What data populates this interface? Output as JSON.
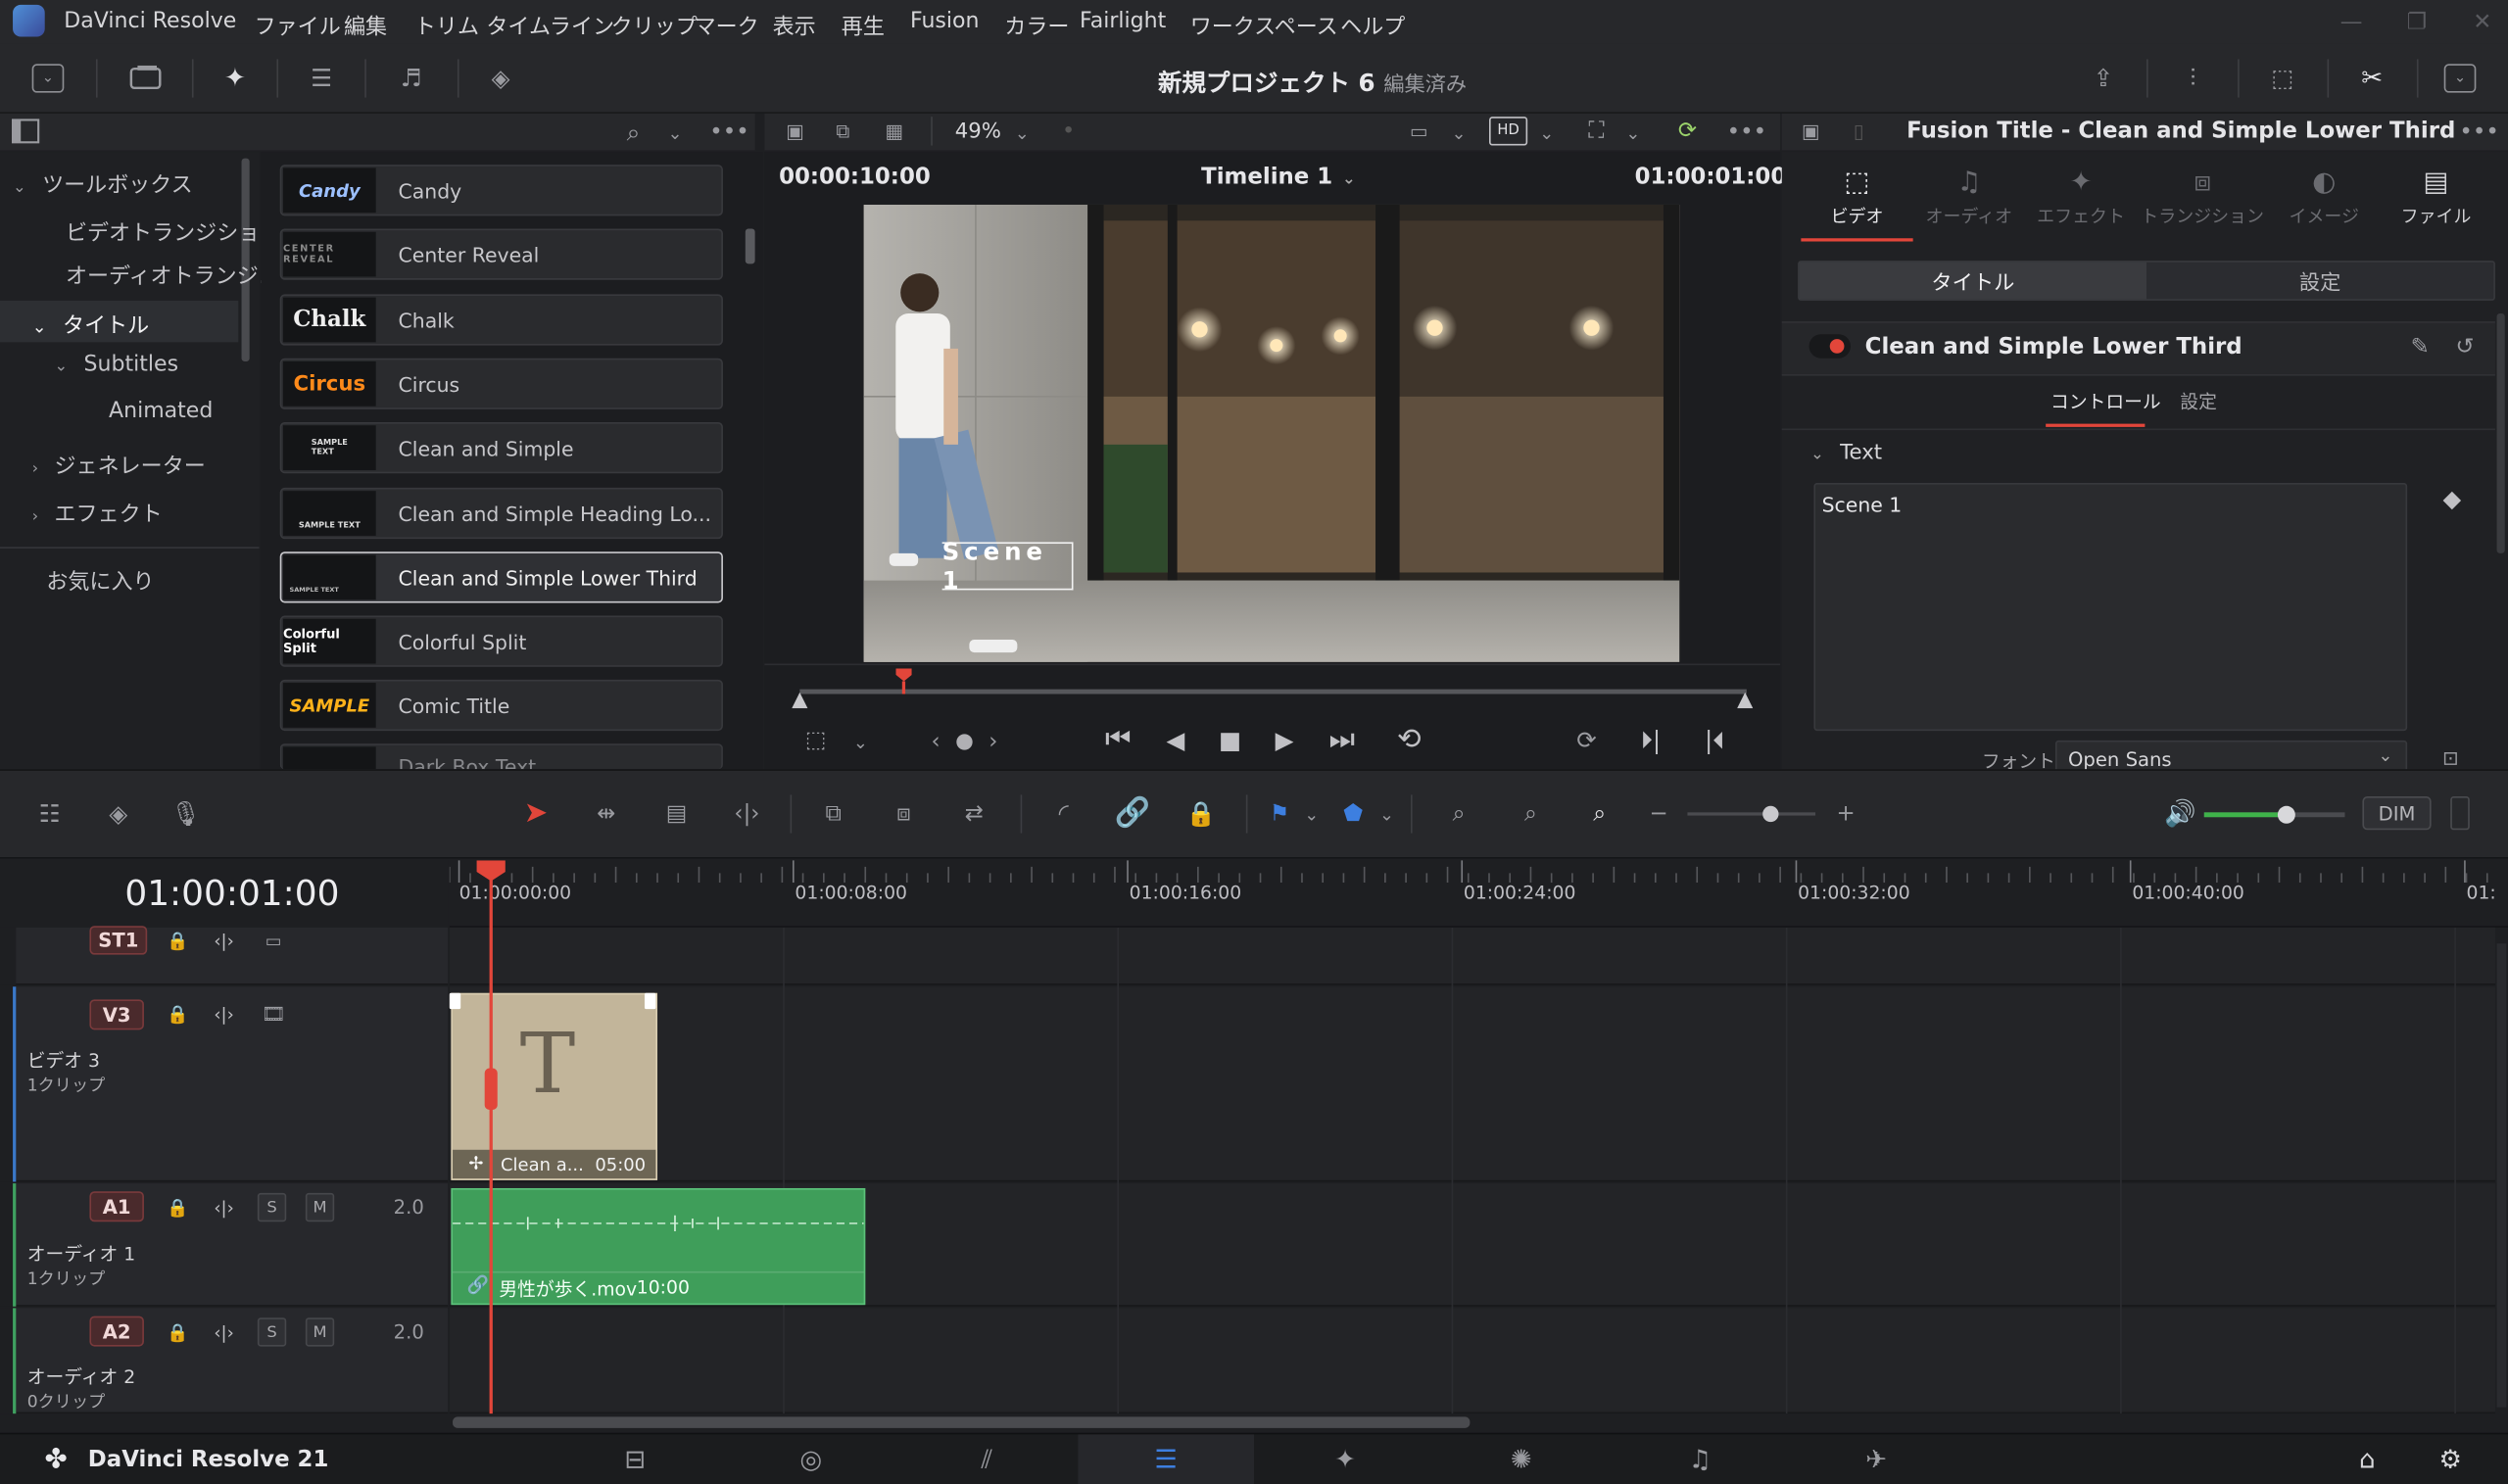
{
  "menubar": {
    "app_name": "DaVinci Resolve",
    "items": [
      "ファイル",
      "編集",
      "トリム",
      "タイムライン",
      "クリップ",
      "マーク",
      "表示",
      "再生",
      "Fusion",
      "カラー",
      "Fairlight",
      "ワークスペース",
      "ヘルプ"
    ]
  },
  "toolbar": {
    "project_name": "新規プロジェクト 6",
    "project_status": "編集済み"
  },
  "media_pool": {
    "tree": {
      "toolbox": "ツールボックス",
      "video_transitions": "ビデオトランジション",
      "audio_transitions": "オーディオトランジ...",
      "titles": "タイトル",
      "subtitles": "Subtitles",
      "animated": "Animated",
      "generators": "ジェネレーター",
      "effects": "エフェクト",
      "favorites": "お気に入り"
    },
    "templates": [
      {
        "name": "Candy",
        "thumb": "Candy",
        "color": "#8fb6ff"
      },
      {
        "name": "Center Reveal",
        "thumb": "CENTER REVEAL",
        "color": "#8a8a8a"
      },
      {
        "name": "Chalk",
        "thumb": "Chalk",
        "color": "#e8e8e8"
      },
      {
        "name": "Circus",
        "thumb": "Circus",
        "color": "#ff8a1a"
      },
      {
        "name": "Clean and Simple",
        "thumb": "SAMPLE TEXT",
        "color": "#d8d8d8"
      },
      {
        "name": "Clean and Simple Heading Lo...",
        "thumb": "SAMPLE TEXT",
        "color": "#d8d8d8"
      },
      {
        "name": "Clean and Simple Lower Third",
        "thumb": "SAMPLE TEXT",
        "color": "#bcbcbc"
      },
      {
        "name": "Colorful Split",
        "thumb": "Colorful Split",
        "color": "#ffffff"
      },
      {
        "name": "Comic Title",
        "thumb": "SAMPLE",
        "color": "#ffb21a"
      },
      {
        "name": "Dark Box Text",
        "thumb": "",
        "color": "#888"
      }
    ]
  },
  "viewer": {
    "zoom": "49%",
    "duration_tc": "00:00:10:00",
    "timeline_name": "Timeline 1",
    "current_tc": "01:00:01:00",
    "overlay_text": "Scene 1",
    "playhead_fraction": 0.11
  },
  "inspector": {
    "title": "Fusion Title - Clean and Simple Lower Third",
    "tabs": [
      "ビデオ",
      "オーディオ",
      "エフェクト",
      "トランジション",
      "イメージ",
      "ファイル"
    ],
    "subtabs": [
      "タイトル",
      "設定"
    ],
    "effect_name": "Clean and Simple Lower Third",
    "control_tabs": [
      "コントロール",
      "設定"
    ],
    "section": "Text",
    "text_value": "Scene 1",
    "font_label": "フォント",
    "font_value": "Open Sans"
  },
  "timeline": {
    "timecode": "01:00:01:00",
    "ruler": [
      "01:00:00:00",
      "01:00:08:00",
      "01:00:16:00",
      "01:00:24:00",
      "01:00:32:00",
      "01:00:40:00",
      "01:"
    ],
    "dim_label": "DIM",
    "tracks": {
      "st1": {
        "badge": "ST1"
      },
      "v3": {
        "badge": "V3",
        "name": "ビデオ 3",
        "clips": "1クリップ"
      },
      "a1": {
        "badge": "A1",
        "name": "オーディオ 1",
        "clips": "1クリップ",
        "level": "2.0"
      },
      "a2": {
        "badge": "A2",
        "name": "オーディオ 2",
        "clips": "0クリップ",
        "level": "2.0"
      }
    },
    "title_clip": {
      "label": "Clean a...",
      "duration": "05:00",
      "glyph": "T"
    },
    "audio_clip": {
      "label": "男性が歩く.mov",
      "duration": "10:00"
    },
    "solo_label": "S",
    "mute_label": "M"
  },
  "pagebar": {
    "brand": "DaVinci Resolve 21"
  }
}
